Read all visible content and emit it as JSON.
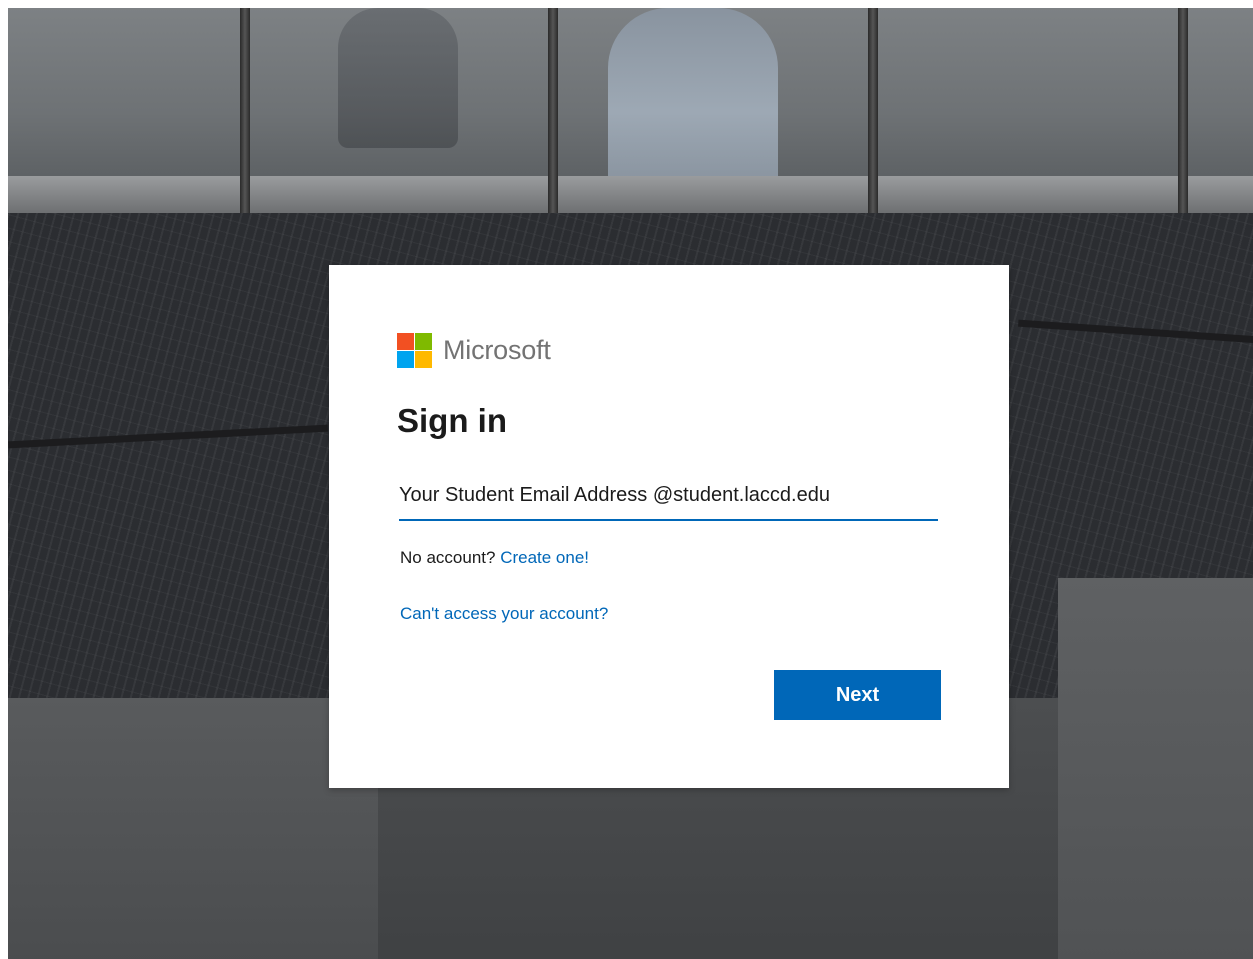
{
  "logo": {
    "text": "Microsoft",
    "colors": [
      "#f25022",
      "#7fba00",
      "#00a4ef",
      "#ffb900"
    ]
  },
  "signin": {
    "title": "Sign in",
    "email_value": "Your Student Email Address @student.laccd.edu",
    "no_account_text": "No account?",
    "create_link": "Create one!",
    "cant_access_link": "Can't access your account?",
    "next_label": "Next"
  },
  "colors": {
    "accent": "#0067b8",
    "text": "#1b1b1b",
    "logo_text": "#737373"
  }
}
